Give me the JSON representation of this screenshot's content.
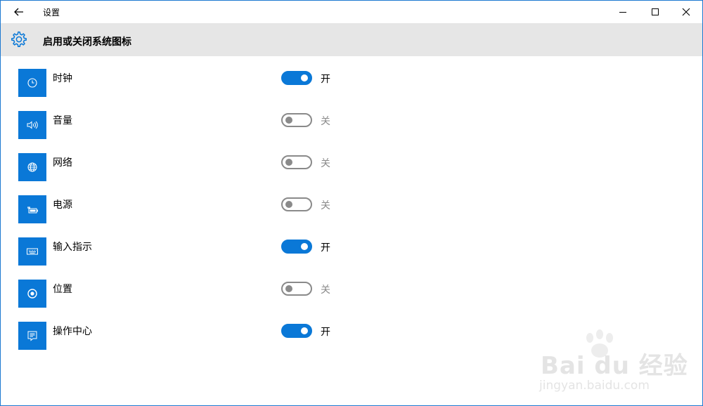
{
  "window": {
    "title": "设置",
    "accent": "#0a78d7"
  },
  "header": {
    "title": "启用或关闭系统图标",
    "icon": "gear-icon"
  },
  "items": [
    {
      "label": "时钟",
      "icon": "clock-icon",
      "on": true,
      "state_label": "开"
    },
    {
      "label": "音量",
      "icon": "volume-icon",
      "on": false,
      "state_label": "关"
    },
    {
      "label": "网络",
      "icon": "globe-icon",
      "on": false,
      "state_label": "关"
    },
    {
      "label": "电源",
      "icon": "battery-icon",
      "on": false,
      "state_label": "关"
    },
    {
      "label": "输入指示",
      "icon": "keyboard-icon",
      "on": true,
      "state_label": "开"
    },
    {
      "label": "位置",
      "icon": "location-icon",
      "on": false,
      "state_label": "关"
    },
    {
      "label": "操作中心",
      "icon": "action-center-icon",
      "on": true,
      "state_label": "开"
    }
  ],
  "watermark": {
    "brand": "Bai du 经验",
    "url": "jingyan.baidu.com"
  }
}
